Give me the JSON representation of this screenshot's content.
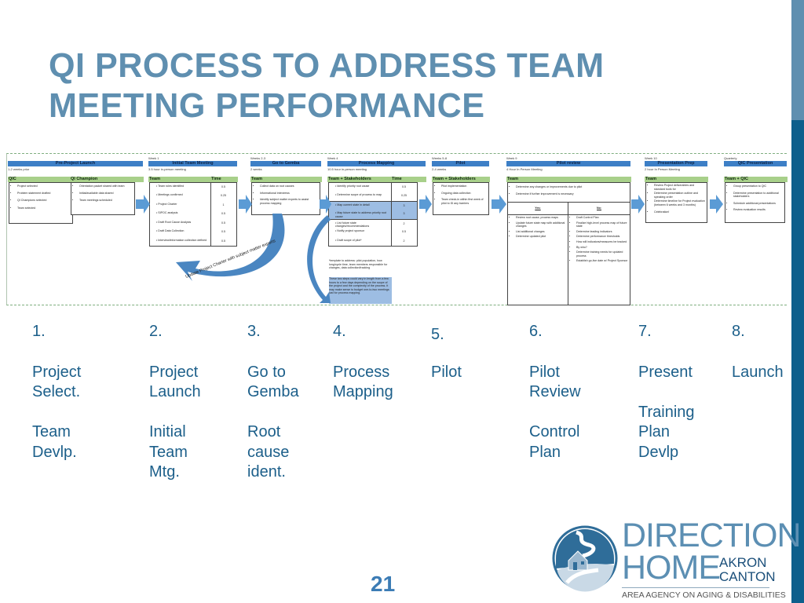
{
  "slide": {
    "title_line1": "QI PROCESS TO ADDRESS TEAM",
    "title_line2": "MEETING PERFORMANCE",
    "page_number": "21",
    "colors": {
      "title": "#5f8fb0",
      "body_text": "#1c5f8a",
      "sidebar_light": "#5f8fb0",
      "sidebar_dark": "#0d5f8c",
      "phase_header": "#3d7fc6",
      "group_header": "#a8d08a",
      "highlight": "#9dbde3"
    }
  },
  "diagram": {
    "phases": [
      {
        "week": "",
        "title": "Pre-Project Launch",
        "subtitle": "1-2 weeks prior",
        "groups": [
          {
            "header": "QIC",
            "items": [
              "Project selected",
              "Problem statement drafted",
              "QI Champions selected",
              "Team selected"
            ]
          },
          {
            "header": "QI Champion",
            "items": [
              "Orientation packet shared with team",
              "Initial/available data shared",
              "Team meetings scheduled"
            ]
          }
        ]
      },
      {
        "week": "Week 1",
        "title": "Initial Team Meeting",
        "subtitle": "3.5 hour in-person meeting",
        "group_header": "Team",
        "time_header": "Time",
        "rows": [
          {
            "item": "Team roles identified",
            "time": "0.5"
          },
          {
            "item": "Meetings confirmed",
            "time": "0.25"
          },
          {
            "item": "Project Charter",
            "time": "1"
          },
          {
            "item": "SIPOC analysis",
            "time": "0.5"
          },
          {
            "item": "Draft Root Cause Analysis",
            "time": "0.5"
          },
          {
            "item": "Draft Data Collection",
            "time": "0.5"
          },
          {
            "item": "Interview/information collection defined",
            "time": "0.5"
          }
        ]
      },
      {
        "week": "Weeks 2-3",
        "title": "Go to Gemba",
        "subtitle": "2 weeks",
        "group_header": "Team",
        "items": [
          "Collect data on root causes",
          "Informational interviews",
          "Identify subject matter experts to assist process mapping"
        ]
      },
      {
        "week": "Week 4",
        "title": "Process Mapping",
        "subtitle": "10.5 hour in-person meeting",
        "group_header": "Team + Stakeholders",
        "time_header": "Time",
        "rows": [
          {
            "item": "Identify priority root cause",
            "time": "0.5"
          },
          {
            "item": "Determine scope of process to map",
            "time": "0.25"
          },
          {
            "item": "Map current state in detail",
            "time": "3",
            "highlight": true
          },
          {
            "item": "Map future state to address priority root cause",
            "time": "3",
            "highlight": true
          },
          {
            "item": "List future state changes/recommendations",
            "time": "2"
          },
          {
            "item": "Notify project sponsor",
            "time": "0.5"
          },
          {
            "item": "Draft scope of pilot*",
            "time": "2"
          }
        ],
        "footnote": "*template to address: pilot population, how long/cycle time, team members responsible for changes, data collection/tracking",
        "highlight_note": "These two steps could vary in length from a few hours to a few days depending on the scope of the project and the complexity of the process. It may make sense to budget one-to-two meetings just for process mapping."
      },
      {
        "week": "Weeks 5-8",
        "title": "Pilot",
        "subtitle": "2-4 weeks",
        "group_header": "Team + Stakeholders",
        "items": [
          "Pilot implementation",
          "Ongoing data collection",
          "Team check-in within first week of pilot to ID any barriers"
        ]
      },
      {
        "week": "Week 9",
        "title": "Pilot review",
        "subtitle": "4 Hour In Person Meeting",
        "group_header": "Team",
        "items": [
          "Determine any changes or improvements due to pilot",
          "Determine if further improvement is necessary"
        ],
        "yes_header": "Yes:",
        "no_header": "No:",
        "yes_items": [
          "Review root cause, process maps",
          "Update future state map with additional changes",
          "List additional changes",
          "Determine updated pilot"
        ],
        "no_items": [
          "Draft Control Plan",
          "Finalize high-level process map of future state",
          "Determine leading indicators",
          "Determine performance thresholds",
          "How will indicators/measures be tracked",
          "By who?",
          "Determine training needs for updated process",
          "Establish go-live date w/ Project Sponsor"
        ]
      },
      {
        "week": "Week 10",
        "title": "Presentation Prep",
        "subtitle": "2 hour In Person Meeting",
        "group_header": "Team",
        "items": [
          "Review Project deliverables and standard tools for",
          "Determine presentation outline and speaking order",
          "Determine timeline for Project evaluation (between 6 weeks and 3 months)",
          "Celebration!"
        ]
      },
      {
        "week": "Quarterly",
        "title": "QIC Presentation",
        "subtitle": "",
        "group_header": "Team + QIC",
        "items": [
          "Group presentation to QIC",
          "Determine presentation to additional stakeholders",
          "Schedule additional presentations",
          "Review evaluation results"
        ]
      }
    ],
    "loop_arrow_label": "Update Project Charter with subject matter experts"
  },
  "steps": [
    {
      "number": "1.",
      "lines": [
        "Project",
        "Select.",
        "",
        "Team",
        "Devlp."
      ]
    },
    {
      "number": "2.",
      "lines": [
        "Project",
        "Launch",
        "",
        "Initial",
        "Team",
        "Mtg."
      ]
    },
    {
      "number": "3.",
      "lines": [
        "Go to",
        "Gemba",
        "",
        "Root",
        "cause",
        "ident."
      ]
    },
    {
      "number": "4.",
      "lines": [
        "Process",
        "Mapping"
      ]
    },
    {
      "number": "5.",
      "lines": [
        "Pilot"
      ]
    },
    {
      "number": "6.",
      "lines": [
        "Pilot",
        "Review",
        "",
        "Control",
        "Plan"
      ]
    },
    {
      "number": "7.",
      "lines": [
        "Present",
        "",
        "Training",
        "Plan",
        "Devlp"
      ]
    },
    {
      "number": "8.",
      "lines": [
        "Launch"
      ]
    }
  ],
  "logo": {
    "brand_line1": "DIRECTION",
    "brand_line2": "HOME",
    "city_line1": "AKRON",
    "city_line2": "CANTON",
    "tagline": "AREA AGENCY ON AGING & DISABILITIES",
    "icon": "house-on-winding-road-icon"
  }
}
